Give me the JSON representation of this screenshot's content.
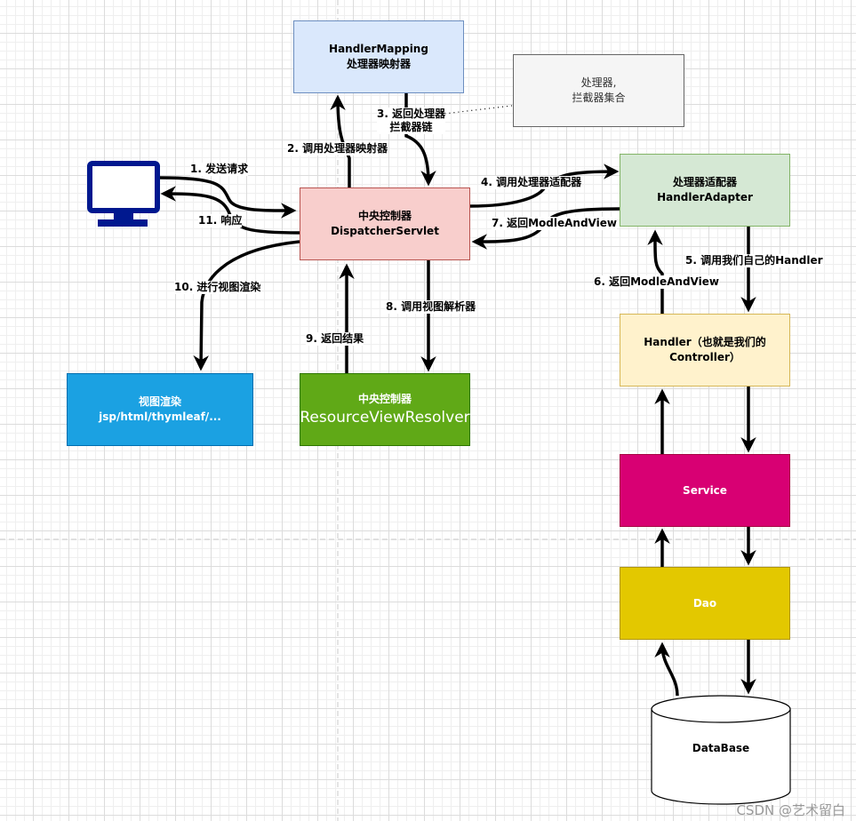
{
  "nodes": {
    "handler_mapping": {
      "line1": "HandlerMapping",
      "line2": "处理器映射器"
    },
    "interceptors": {
      "line1": "处理器,",
      "line2": "拦截器集合"
    },
    "dispatcher": {
      "line1": "中央控制器",
      "line2": "DispatcherServlet"
    },
    "adapter": {
      "line1": "处理器适配器",
      "line2": "HandlerAdapter"
    },
    "handler": {
      "line1": "Handler（也就是我们的",
      "line2": "Controller）"
    },
    "service": {
      "label": "Service"
    },
    "dao": {
      "label": "Dao"
    },
    "database": {
      "label": "DataBase"
    },
    "view": {
      "line1": "视图渲染",
      "line2": "jsp/html/thymleaf/..."
    },
    "resolver": {
      "line1": "中央控制器",
      "line2": "ResourceViewResolver"
    }
  },
  "edges": {
    "e1": "1. 发送请求",
    "e2": "2. 调用处理器映射器",
    "e3a": "3. 返回处理器",
    "e3b": "拦截器链",
    "e4": "4. 调用处理器适配器",
    "e5": "5. 调用我们自己的Handler",
    "e6": "6. 返回ModleAndView",
    "e7": "7. 返回ModleAndView",
    "e8": "8. 调用视图解析器",
    "e9": "9. 返回结果",
    "e10": "10. 进行视图渲染",
    "e11": "11. 响应"
  },
  "colors": {
    "monitor": "#00188f",
    "mapping": "#dae8fc",
    "dispatcher": "#f8cecc",
    "adapter": "#d5e8d4",
    "handler": "#fff2cc",
    "service": "#d80073",
    "dao": "#e3c800",
    "view": "#1ba1e2",
    "resolver": "#60a917"
  },
  "watermark": "CSDN @艺术留白"
}
